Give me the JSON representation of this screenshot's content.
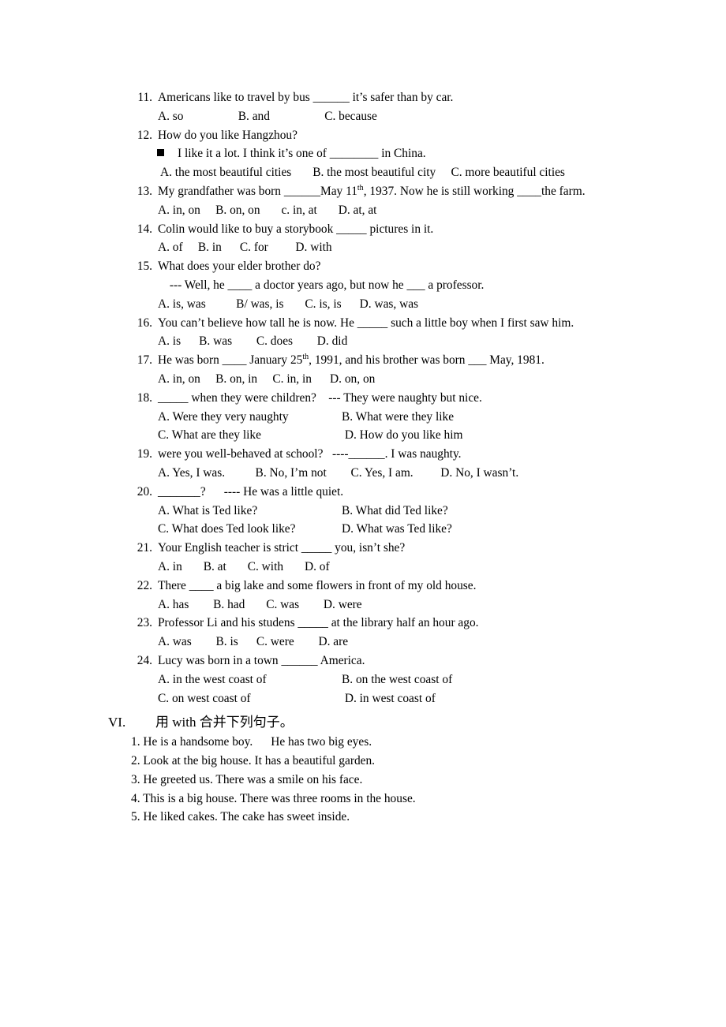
{
  "document": {
    "questions": [
      {
        "number": "11.",
        "stem": "Americans like to travel by bus ______ it’s safer than by car.",
        "options_line": "A. so                  B. and                  C. because"
      },
      {
        "number": "12.",
        "stem": "How do you like Hangzhou?",
        "response": "I like it a lot. I think it’s one of ________ in China.",
        "options_line": " A. the most beautiful cities       B. the most beautiful city     C. more beautiful cities"
      },
      {
        "number": "13.",
        "stem_before_sup": "My grandfather was born ______May 11",
        "stem_sup": "th",
        "stem_after_sup": ", 1937. Now he is still working ____the farm.",
        "options_line": "A. in, on     B. on, on       c. in, at       D. at, at"
      },
      {
        "number": "14.",
        "stem": "Colin would like to buy a storybook _____ pictures in it.",
        "options_line": "A. of     B. in      C. for         D. with"
      },
      {
        "number": "15.",
        "stem": "What does your elder brother do?",
        "response_plain": " --- Well, he ____ a doctor years ago, but now he ___ a professor.",
        "options_line": "A. is, was          B/ was, is       C. is, is      D. was, was"
      },
      {
        "number": "16.",
        "stem": "You can’t believe how tall he is now. He _____ such a little boy when I first saw him.",
        "options_line": "A. is      B. was        C. does        D. did"
      },
      {
        "number": "17.",
        "stem_before_sup": "He was born ____ January 25",
        "stem_sup": "th",
        "stem_after_sup": ", 1991, and his brother was born ___ May, 1981.",
        "options_line": "A. in, on     B. on, in     C. in, in      D. on, on"
      },
      {
        "number": "18.",
        "stem": "_____ when they were children?    --- They were naughty but nice.",
        "option_a": "A. Were they very naughty",
        "option_b": "B. What were they like",
        "option_c": "C. What are they like",
        "option_d": " D. How do you like him"
      },
      {
        "number": "19.",
        "stem": "were you well-behaved at school?   ----______. I was naughty.",
        "options_line": "A. Yes, I was.          B. No, I’m not        C. Yes, I am.         D. No, I wasn’t."
      },
      {
        "number": "20.",
        "stem": "_______?      ---- He was a little quiet.",
        "option_a": "A. What is Ted like?",
        "option_b": "B. What did Ted like?",
        "option_c": "C. What does Ted look like?",
        "option_d": "D. What was Ted like?"
      },
      {
        "number": "21.",
        "stem": "Your English teacher is strict _____ you, isn’t she?",
        "options_line": "A. in       B. at       C. with       D. of"
      },
      {
        "number": "22.",
        "stem": "There ____ a big lake and some flowers in front of my old house.",
        "options_line": "A. has        B. had       C. was        D. were"
      },
      {
        "number": "23.",
        "stem": "Professor Li and his studens _____ at the library half an hour ago.",
        "options_line": "A. was        B. is      C. were        D. are"
      },
      {
        "number": "24.",
        "stem": "Lucy was born in a town ______ America.",
        "option_a": "A. in the west coast of",
        "option_b": "B. on the west coast of",
        "option_c": "C. on west coast of",
        "option_d": " D. in west coast of"
      }
    ],
    "section": {
      "number": "VI.",
      "title": "用 with 合并下列句子。",
      "items": [
        "1. He is a handsome boy.      He has two big eyes.",
        "2. Look at the big house. It has a beautiful garden.",
        "3. He greeted us. There was a smile on his face.",
        "4. This is a big house. There was three rooms in the house.",
        "5. He liked cakes. The cake has sweet inside."
      ]
    }
  }
}
